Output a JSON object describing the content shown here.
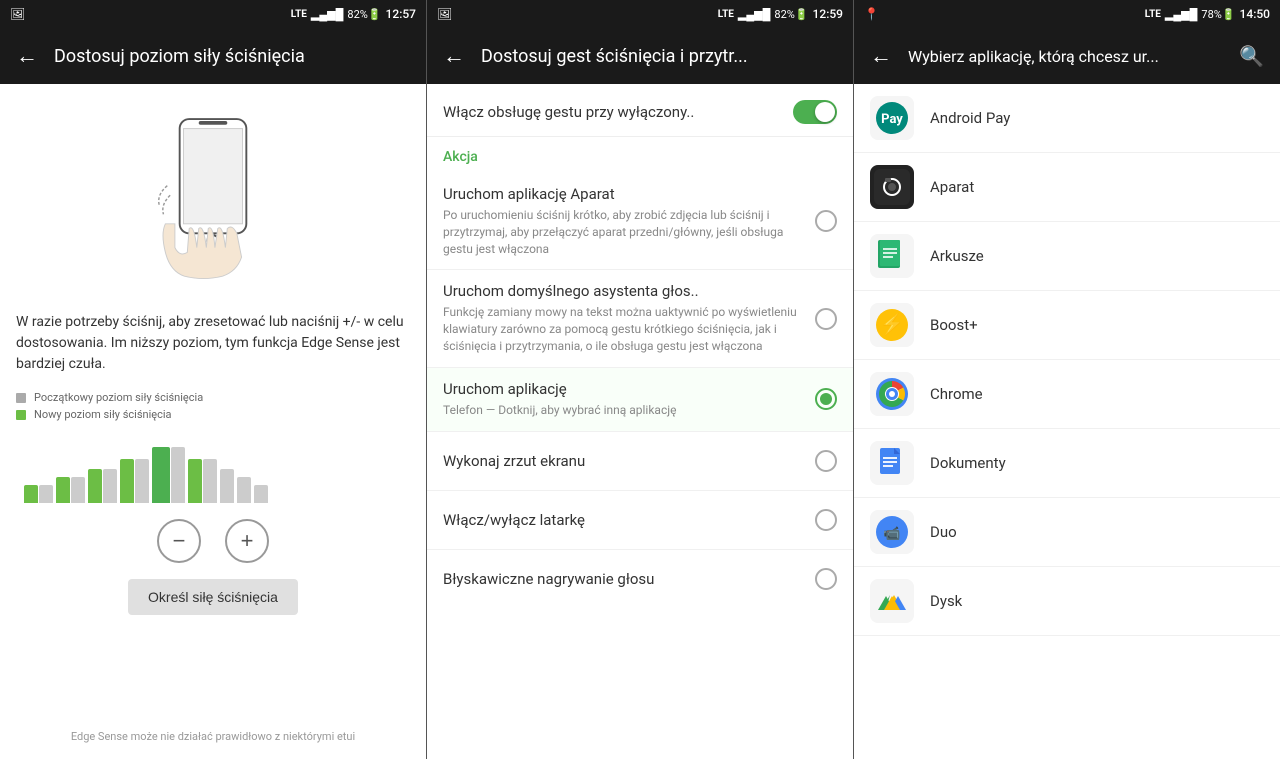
{
  "statusBars": [
    {
      "leftIcon": "photo",
      "signal": "LTE",
      "battery": 82,
      "time": "12:57"
    },
    {
      "leftIcon": "photo",
      "signal": "LTE",
      "battery": 82,
      "time": "12:59"
    },
    {
      "rightIcon": "location",
      "signal": "LTE",
      "battery": 78,
      "time": "14:50"
    }
  ],
  "panel1": {
    "title": "Dostosuj poziom siły ściśnięcia",
    "instructionText": "W razie potrzeby ściśnij, aby zresetować lub naciśnij +/- w celu dostosowania. Im niższy poziom, tym funkcja Edge Sense jest bardziej czuła.",
    "legend": [
      {
        "color": "#aaa",
        "label": "Początkowy poziom siły ściśnięcia"
      },
      {
        "color": "#6cbe45",
        "label": "Nowy poziom siły ściśnięcia"
      }
    ],
    "calibrateBtn": "Określ siłę ściśnięcia",
    "footerNote": "Edge Sense może nie działać prawidłowo z niektórymi etui",
    "minusLabel": "−",
    "plusLabel": "+"
  },
  "panel2": {
    "title": "Dostosuj gest ściśnięcia i przytr...",
    "toggleLabel": "Włącz obsługę gestu przy wyłączony..",
    "toggleOn": true,
    "sectionLabel": "Akcja",
    "options": [
      {
        "title": "Uruchom aplikację Aparat",
        "desc": "Po uruchomieniu ściśnij krótko, aby zrobić zdjęcia lub ściśnij i przytrzymaj, aby przełączyć aparat przedni/główny, jeśli obsługa gestu jest włączona",
        "selected": false
      },
      {
        "title": "Uruchom domyślnego asystenta głos..",
        "desc": "Funkcję zamiany mowy na tekst można uaktywnić po wyświetleniu klawiatury zarówno za pomocą gestu krótkiego ściśnięcia, jak i ściśnięcia i przytrzymania, o ile obsługa gestu jest włączona",
        "selected": false
      },
      {
        "title": "Uruchom aplikację",
        "desc": "Telefon — Dotknij, aby wybrać inną aplikację",
        "selected": true
      }
    ],
    "simpleOptions": [
      {
        "label": "Wykonaj zrzut ekranu"
      },
      {
        "label": "Włącz/wyłącz latarkę"
      },
      {
        "label": "Błyskawiczne nagrywanie głosu"
      }
    ]
  },
  "panel3": {
    "title": "Wybierz aplikację, którą chcesz ur...",
    "apps": [
      {
        "name": "Android Pay",
        "iconType": "android-pay"
      },
      {
        "name": "Aparat",
        "iconType": "camera"
      },
      {
        "name": "Arkusze",
        "iconType": "sheets"
      },
      {
        "name": "Boost+",
        "iconType": "boost"
      },
      {
        "name": "Chrome",
        "iconType": "chrome"
      },
      {
        "name": "Dokumenty",
        "iconType": "docs"
      },
      {
        "name": "Duo",
        "iconType": "duo"
      },
      {
        "name": "Dysk",
        "iconType": "drive"
      }
    ]
  }
}
